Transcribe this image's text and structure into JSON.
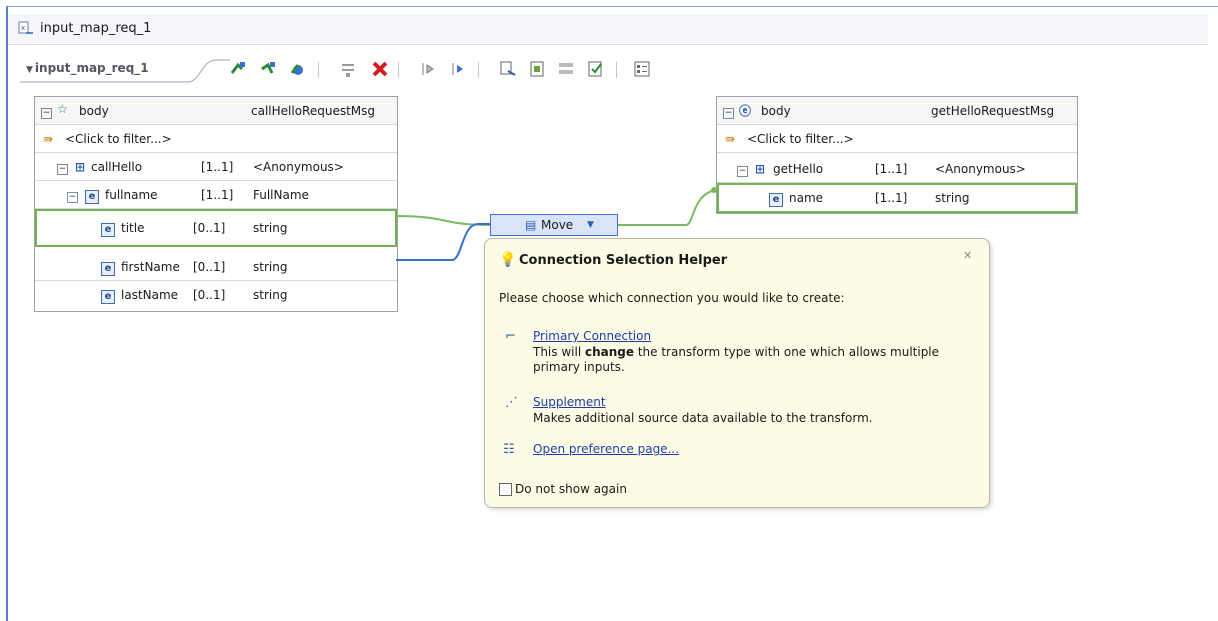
{
  "window": {
    "title": "input_map_req_1"
  },
  "toolbar": {
    "tab_label": "input_map_req_1"
  },
  "left_panel": {
    "header": {
      "name": "body",
      "type": "callHelloRequestMsg"
    },
    "filter": "<Click to filter...>",
    "rows": [
      {
        "name": "callHello",
        "card": "[1..1]",
        "type": "<Anonymous>"
      },
      {
        "name": "fullname",
        "card": "[1..1]",
        "type": "FullName"
      },
      {
        "name": "title",
        "card": "[0..1]",
        "type": "string"
      },
      {
        "name": "firstName",
        "card": "[0..1]",
        "type": "string"
      },
      {
        "name": "lastName",
        "card": "[0..1]",
        "type": "string"
      }
    ]
  },
  "right_panel": {
    "header": {
      "name": "body",
      "type": "getHelloRequestMsg"
    },
    "filter": "<Click to filter...>",
    "rows": [
      {
        "name": "getHello",
        "card": "[1..1]",
        "type": "<Anonymous>"
      },
      {
        "name": "name",
        "card": "[1..1]",
        "type": "string"
      }
    ]
  },
  "move": {
    "label": "Move"
  },
  "popup": {
    "title": "Connection Selection Helper",
    "message": "Please choose which connection you would like to create:",
    "primary": {
      "link": "Primary Connection",
      "desc_pre": "This will ",
      "desc_bold": "change",
      "desc_post": " the transform type with one which allows multiple",
      "desc_line2": "primary inputs."
    },
    "supplement": {
      "link": "Supplement",
      "desc": "Makes additional source data available to the transform."
    },
    "pref_link": "Open preference page...",
    "checkbox_label": "Do not show again"
  },
  "colors": {
    "connection": "#7ab862",
    "selected_connection": "#3a6fcf",
    "popup_bg": "#fcfce6"
  }
}
